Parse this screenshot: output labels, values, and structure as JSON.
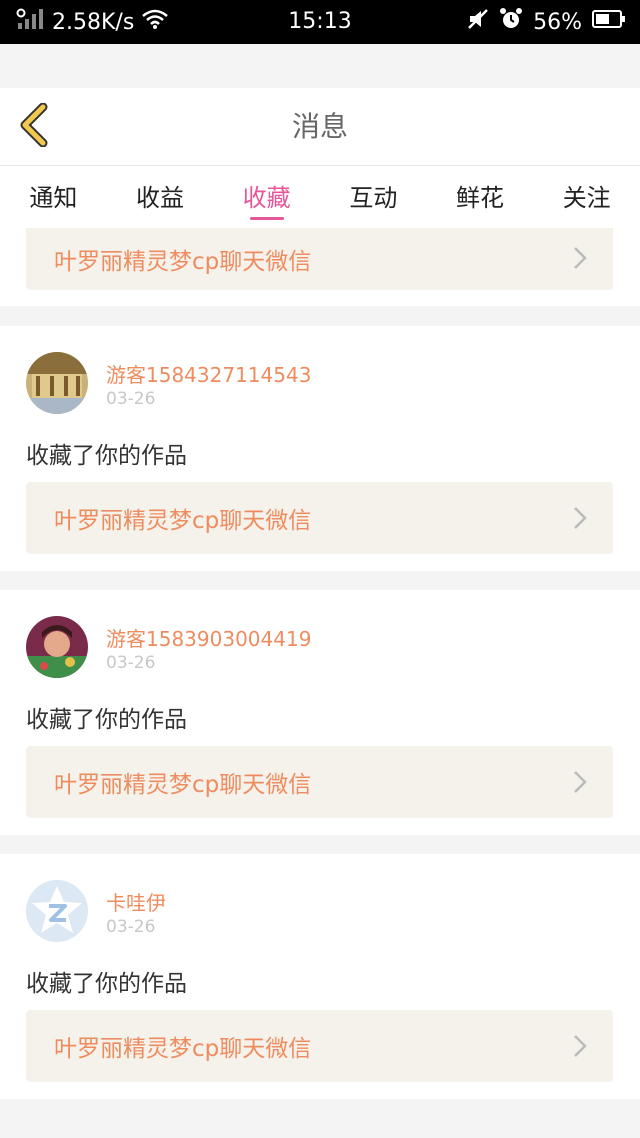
{
  "status_bar": {
    "network_speed": "2.58K/s",
    "time": "15:13",
    "battery": "56%",
    "icons": [
      "signal-icon",
      "wifi-icon",
      "mute-icon",
      "alarm-icon",
      "battery-icon"
    ]
  },
  "header": {
    "back_icon": "chevron-left-icon",
    "title": "消息"
  },
  "tabs": [
    {
      "label": "通知",
      "active": false
    },
    {
      "label": "收益",
      "active": false
    },
    {
      "label": "收藏",
      "active": true
    },
    {
      "label": "互动",
      "active": false
    },
    {
      "label": "鲜花",
      "active": false
    },
    {
      "label": "关注",
      "active": false
    }
  ],
  "partial_card": {
    "work_title": "叶罗丽精灵梦cp聊天微信"
  },
  "notifications": [
    {
      "username": "游客1584327114543",
      "date": "03-26",
      "action": "收藏了你的作品",
      "work_title": "叶罗丽精灵梦cp聊天微信"
    },
    {
      "username": "游客1583903004419",
      "date": "03-26",
      "action": "收藏了你的作品",
      "work_title": "叶罗丽精灵梦cp聊天微信"
    },
    {
      "username": "卡哇伊",
      "date": "03-26",
      "action": "收藏了你的作品",
      "work_title": "叶罗丽精灵梦cp聊天微信"
    }
  ],
  "colors": {
    "accent_pink": "#e6589a",
    "username_orange": "#ef8c5f",
    "back_icon_yellow": "#f2c94c",
    "link_bg": "#f4f2eb"
  }
}
